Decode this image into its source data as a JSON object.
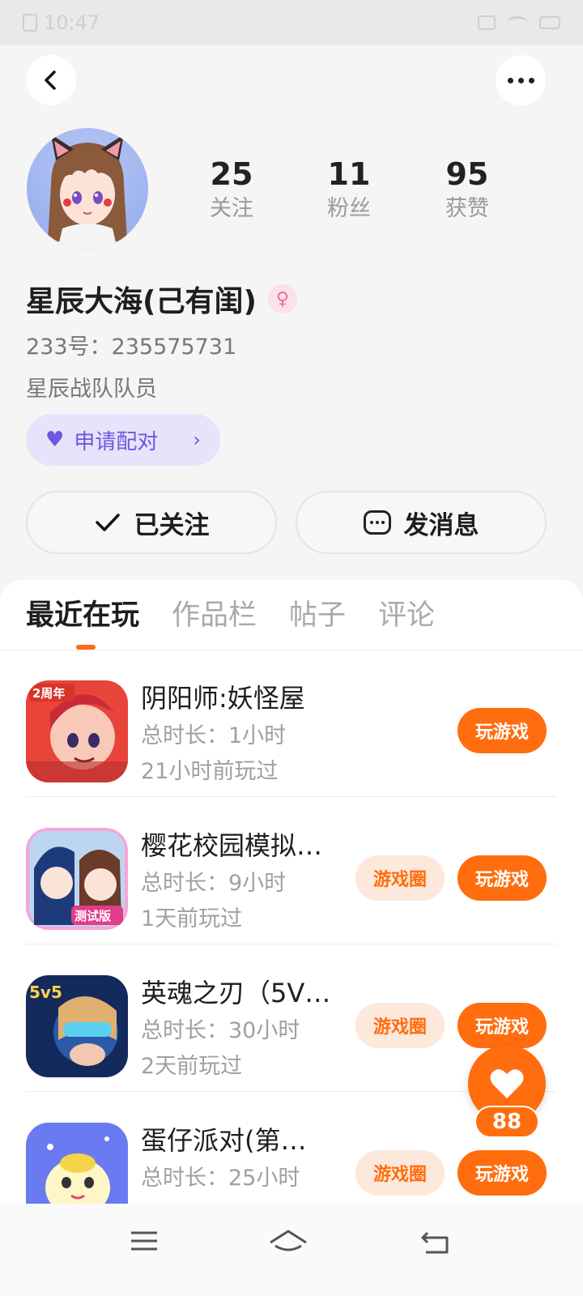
{
  "status_bar": {
    "time": "10:47"
  },
  "profile": {
    "stats": [
      {
        "value": "25",
        "label": "关注"
      },
      {
        "value": "11",
        "label": "粉丝"
      },
      {
        "value": "95",
        "label": "获赞"
      }
    ],
    "username": "星辰大海(己有闺)",
    "uid": "233号：235575731",
    "bio": "星辰战队队员",
    "pair_button": "申请配对",
    "follow_button": "已关注",
    "message_button": "发消息"
  },
  "tabs": [
    "最近在玩",
    "作品栏",
    "帖子",
    "评论"
  ],
  "games": [
    {
      "title": "阴阳师:妖怪屋",
      "duration": "总时长：1小时",
      "last_played": "21小时前玩过",
      "play": "玩游戏",
      "circle": "",
      "icon_badge": "2周年"
    },
    {
      "title": "樱花校园模拟…",
      "duration": "总时长：9小时",
      "last_played": "1天前玩过",
      "play": "玩游戏",
      "circle": "游戏圈",
      "icon_badge": "测试版"
    },
    {
      "title": "英魂之刃（5V…",
      "duration": "总时长：30小时",
      "last_played": "2天前玩过",
      "play": "玩游戏",
      "circle": "游戏圈",
      "icon_badge": "5v5"
    },
    {
      "title": "蛋仔派对(第…",
      "duration": "总时长：25小时",
      "last_played": "",
      "play": "玩游戏",
      "circle": "游戏圈",
      "icon_badge": ""
    }
  ],
  "like_fab": {
    "count": "88"
  },
  "colors": {
    "accent": "#ff6d0e",
    "pair": "#6a58e0"
  },
  "icons": {
    "back": "back-arrow-icon",
    "more": "more-dots-icon",
    "check": "check-icon",
    "message": "chat-bubble-icon",
    "heart": "heart-icon"
  }
}
